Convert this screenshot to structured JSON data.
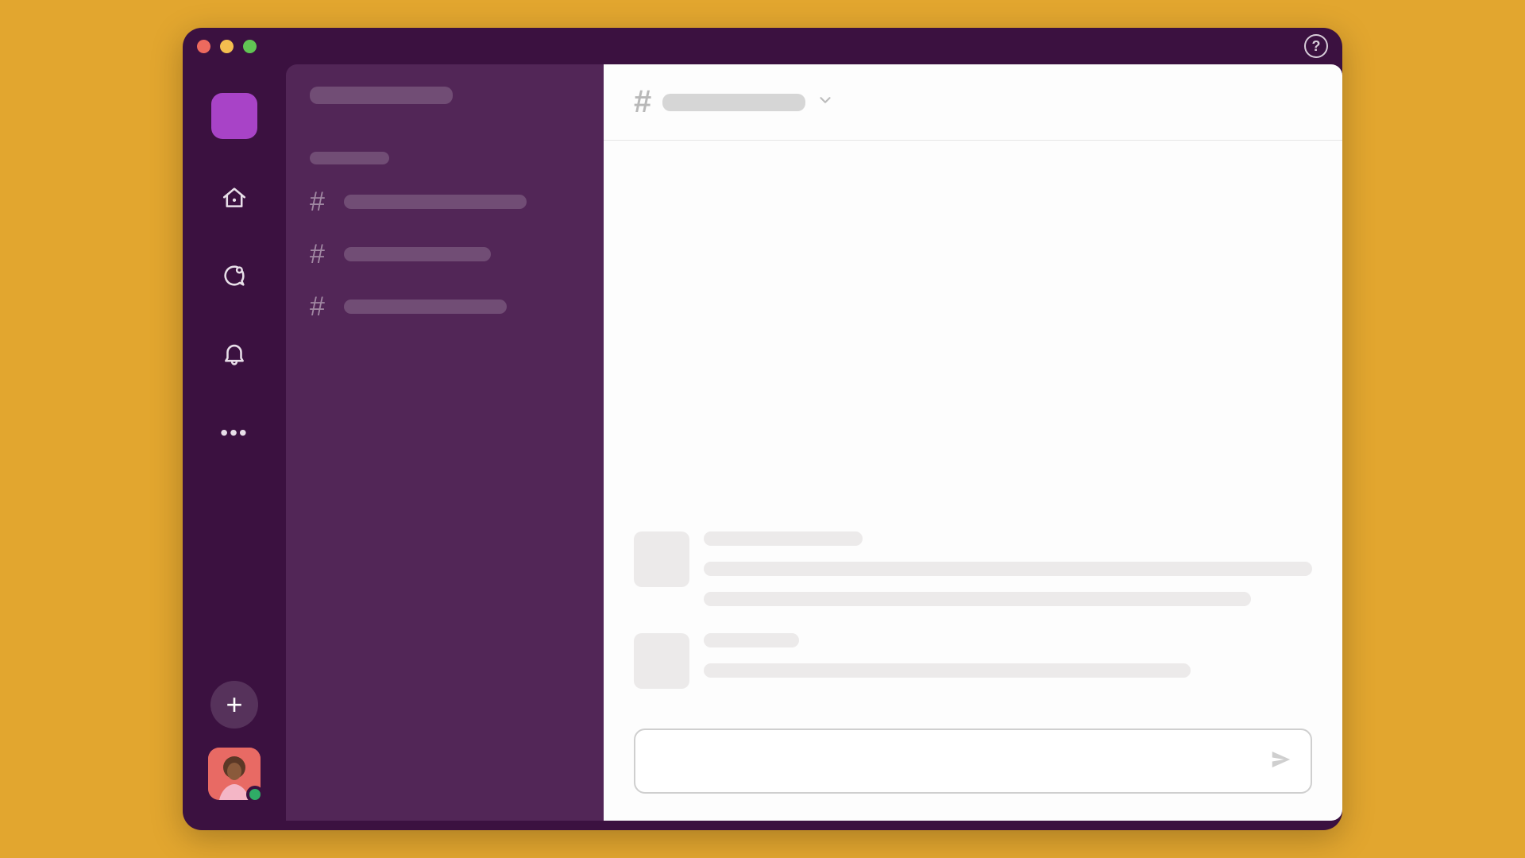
{
  "window": {
    "help_label": "?"
  },
  "rail": {
    "icons": {
      "home": "home-icon",
      "dm": "dm-icon",
      "activity": "bell-icon",
      "more": "more-icon",
      "add": "plus-icon"
    },
    "user": {
      "presence": "active"
    }
  },
  "sidebar": {
    "workspace_name": "",
    "section_label": "",
    "channels": [
      {
        "name": ""
      },
      {
        "name": ""
      },
      {
        "name": ""
      }
    ]
  },
  "channel_header": {
    "hash": "#",
    "name": ""
  },
  "messages": [
    {
      "author": "",
      "lines": [
        "",
        ""
      ]
    },
    {
      "author": "",
      "lines": [
        ""
      ]
    }
  ],
  "composer": {
    "placeholder": "",
    "value": ""
  }
}
